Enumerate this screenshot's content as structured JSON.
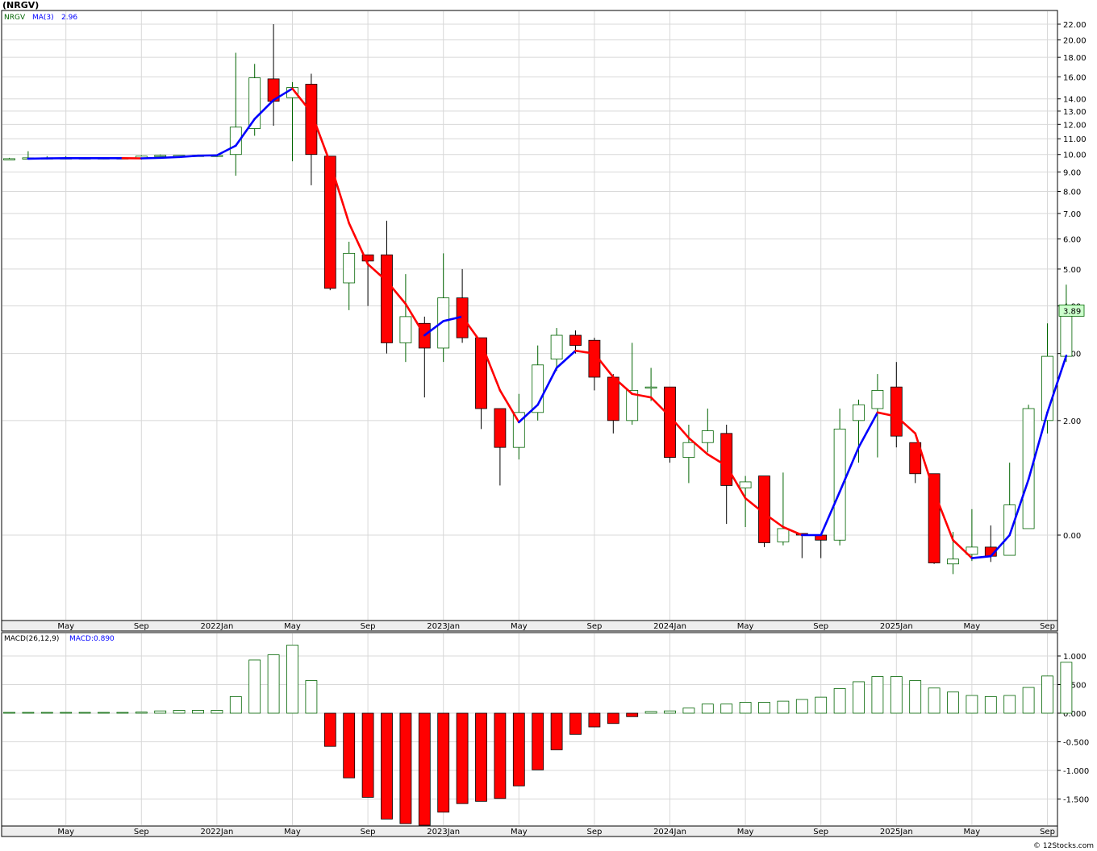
{
  "title": "(NRGV)",
  "watermark": "© 12Stocks.com",
  "legend": {
    "symbol": "NRGV",
    "ma_label": "MA(3)",
    "ma_value": "2.96",
    "macd_params": "MACD(26,12,9)",
    "macd_label": "MACD:0.890"
  },
  "last_price": "3.89",
  "colors": {
    "up": "#006400",
    "down": "#ff0000",
    "ma_up": "#0000ff",
    "ma_down": "#ff0000",
    "last_price_bg": "#ccffcc",
    "grid": "#d8d8d8",
    "axis_strip": "#eeeeee"
  },
  "chart_data": [
    {
      "type": "candlestick",
      "scale": "log",
      "title": "(NRGV)",
      "y_tick_labels": [
        "22.00",
        "20.00",
        "18.00",
        "16.00",
        "14.00",
        "13.00",
        "12.00",
        "11.00",
        "10.00",
        "9.00",
        "8.00",
        "7.00",
        "6.00",
        "5.00",
        "4.00",
        "3.00",
        "2.00",
        "0.00"
      ],
      "y_tick_values": [
        22,
        20,
        18,
        16,
        14,
        13,
        12,
        11,
        10,
        9,
        8,
        7,
        6,
        5,
        4,
        3,
        2,
        1
      ],
      "x_tick_labels": [
        "May",
        "Sep",
        "2022Jan",
        "May",
        "Sep",
        "2023Jan",
        "May",
        "Sep",
        "2024Jan",
        "May",
        "Sep",
        "2025Jan",
        "May",
        "Sep"
      ],
      "x_tick_month_index": [
        3,
        7,
        11,
        15,
        19,
        23,
        27,
        31,
        35,
        39,
        43,
        47,
        51,
        55
      ],
      "candles": [
        {
          "o": 9.75,
          "h": 9.8,
          "l": 9.7,
          "c": 9.75
        },
        {
          "o": 9.75,
          "h": 10.2,
          "l": 9.7,
          "c": 9.8
        },
        {
          "o": 9.78,
          "h": 9.9,
          "l": 9.72,
          "c": 9.8
        },
        {
          "o": 9.8,
          "h": 9.9,
          "l": 9.75,
          "c": 9.8
        },
        {
          "o": 9.8,
          "h": 9.8,
          "l": 9.8,
          "c": 9.8
        },
        {
          "o": 9.8,
          "h": 9.8,
          "l": 9.8,
          "c": 9.8
        },
        {
          "o": 9.8,
          "h": 9.8,
          "l": 9.8,
          "c": 9.8
        },
        {
          "o": 9.75,
          "h": 9.95,
          "l": 9.7,
          "c": 9.9
        },
        {
          "o": 9.9,
          "h": 10.0,
          "l": 9.85,
          "c": 9.95
        },
        {
          "o": 9.95,
          "h": 9.95,
          "l": 9.95,
          "c": 9.95
        },
        {
          "o": 9.95,
          "h": 9.95,
          "l": 9.95,
          "c": 9.95
        },
        {
          "o": 9.95,
          "h": 9.95,
          "l": 9.95,
          "c": 9.95
        },
        {
          "o": 10.0,
          "h": 18.5,
          "l": 8.8,
          "c": 11.8
        },
        {
          "o": 11.7,
          "h": 17.3,
          "l": 11.2,
          "c": 15.9
        },
        {
          "o": 15.8,
          "h": 22.0,
          "l": 11.9,
          "c": 13.8
        },
        {
          "o": 14.1,
          "h": 15.5,
          "l": 9.6,
          "c": 15.0
        },
        {
          "o": 15.3,
          "h": 16.3,
          "l": 8.3,
          "c": 10.0
        },
        {
          "o": 9.9,
          "h": 9.9,
          "l": 4.4,
          "c": 4.45
        },
        {
          "o": 4.6,
          "h": 5.9,
          "l": 3.9,
          "c": 5.5
        },
        {
          "o": 5.45,
          "h": 5.45,
          "l": 4.0,
          "c": 5.25
        },
        {
          "o": 5.45,
          "h": 6.7,
          "l": 3.0,
          "c": 3.2
        },
        {
          "o": 3.2,
          "h": 4.85,
          "l": 2.85,
          "c": 3.75
        },
        {
          "o": 3.6,
          "h": 3.75,
          "l": 2.3,
          "c": 3.1
        },
        {
          "o": 3.1,
          "h": 5.5,
          "l": 2.85,
          "c": 4.2
        },
        {
          "o": 4.2,
          "h": 5.0,
          "l": 3.2,
          "c": 3.3
        },
        {
          "o": 3.3,
          "h": 3.3,
          "l": 1.9,
          "c": 2.15
        },
        {
          "o": 2.15,
          "h": 2.15,
          "l": 1.35,
          "c": 1.7
        },
        {
          "o": 1.7,
          "h": 2.35,
          "l": 1.58,
          "c": 2.1
        },
        {
          "o": 2.1,
          "h": 3.15,
          "l": 2.0,
          "c": 2.8
        },
        {
          "o": 2.9,
          "h": 3.5,
          "l": 2.7,
          "c": 3.35
        },
        {
          "o": 3.35,
          "h": 3.45,
          "l": 3.0,
          "c": 3.15
        },
        {
          "o": 3.25,
          "h": 3.3,
          "l": 2.4,
          "c": 2.6
        },
        {
          "o": 2.6,
          "h": 2.65,
          "l": 1.85,
          "c": 2.0
        },
        {
          "o": 2.0,
          "h": 3.2,
          "l": 1.95,
          "c": 2.4
        },
        {
          "o": 2.45,
          "h": 2.75,
          "l": 2.25,
          "c": 2.45
        },
        {
          "o": 2.45,
          "h": 2.45,
          "l": 1.55,
          "c": 1.6
        },
        {
          "o": 1.6,
          "h": 1.95,
          "l": 1.37,
          "c": 1.75
        },
        {
          "o": 1.75,
          "h": 2.15,
          "l": 1.65,
          "c": 1.88
        },
        {
          "o": 1.85,
          "h": 1.95,
          "l": 1.07,
          "c": 1.35
        },
        {
          "o": 1.33,
          "h": 1.43,
          "l": 1.05,
          "c": 1.38
        },
        {
          "o": 1.43,
          "h": 1.43,
          "l": 0.93,
          "c": 0.955
        },
        {
          "o": 0.96,
          "h": 1.46,
          "l": 0.94,
          "c": 1.04
        },
        {
          "o": 1.01,
          "h": 1.01,
          "l": 0.87,
          "c": 1.0
        },
        {
          "o": 1.0,
          "h": 1.0,
          "l": 0.87,
          "c": 0.97
        },
        {
          "o": 0.97,
          "h": 2.15,
          "l": 0.94,
          "c": 1.9
        },
        {
          "o": 2.0,
          "h": 2.27,
          "l": 1.55,
          "c": 2.2
        },
        {
          "o": 2.15,
          "h": 2.65,
          "l": 1.6,
          "c": 2.4
        },
        {
          "o": 2.45,
          "h": 2.85,
          "l": 1.7,
          "c": 1.82
        },
        {
          "o": 1.75,
          "h": 1.75,
          "l": 1.37,
          "c": 1.45
        },
        {
          "o": 1.45,
          "h": 1.45,
          "l": 0.84,
          "c": 0.845
        },
        {
          "o": 0.84,
          "h": 1.02,
          "l": 0.79,
          "c": 0.865
        },
        {
          "o": 0.89,
          "h": 1.17,
          "l": 0.855,
          "c": 0.93
        },
        {
          "o": 0.93,
          "h": 1.06,
          "l": 0.85,
          "c": 0.88
        },
        {
          "o": 0.885,
          "h": 1.55,
          "l": 0.885,
          "c": 1.2
        },
        {
          "o": 1.04,
          "h": 2.2,
          "l": 1.04,
          "c": 2.15
        },
        {
          "o": 2.0,
          "h": 3.6,
          "l": 1.85,
          "c": 2.95
        },
        {
          "o": 2.95,
          "h": 4.55,
          "l": 2.85,
          "c": 3.89
        }
      ],
      "ma": {
        "name": "MA(3)",
        "values": [
          null,
          9.75,
          9.77,
          9.78,
          9.78,
          9.78,
          9.78,
          9.77,
          9.8,
          9.85,
          9.93,
          9.95,
          10.55,
          12.4,
          13.9,
          14.9,
          12.9,
          9.5,
          6.6,
          5.15,
          4.65,
          4.05,
          3.35,
          3.65,
          3.75,
          3.2,
          2.4,
          1.98,
          2.2,
          2.75,
          3.05,
          3.0,
          2.6,
          2.35,
          2.3,
          2.05,
          1.8,
          1.63,
          1.52,
          1.25,
          1.14,
          1.05,
          1.0,
          1.0,
          1.3,
          1.7,
          2.1,
          2.05,
          1.85,
          1.3,
          0.97,
          0.87,
          0.88,
          1.0,
          1.4,
          2.1,
          2.96
        ]
      }
    },
    {
      "type": "bar",
      "title": "MACD(26,12,9)",
      "y_tick_labels": [
        "1.000",
        "0.500",
        "0.000",
        "-0.500",
        "-1.000",
        "-1.500"
      ],
      "y_tick_values": [
        1.0,
        0.5,
        0.0,
        -0.5,
        -1.0,
        -1.5
      ],
      "x_tick_labels": [
        "May",
        "Sep",
        "2022Jan",
        "May",
        "Sep",
        "2023Jan",
        "May",
        "Sep",
        "2024Jan",
        "May",
        "Sep",
        "2025Jan",
        "May",
        "Sep"
      ],
      "values": [
        0,
        0,
        0,
        0,
        0,
        0,
        0.01,
        0.02,
        0.04,
        0.05,
        0.05,
        0.05,
        0.29,
        0.93,
        1.02,
        1.19,
        0.57,
        -0.58,
        -1.13,
        -1.47,
        -1.85,
        -1.93,
        -1.96,
        -1.73,
        -1.58,
        -1.54,
        -1.49,
        -1.27,
        -0.99,
        -0.64,
        -0.37,
        -0.24,
        -0.18,
        -0.06,
        0.03,
        0.04,
        0.09,
        0.16,
        0.16,
        0.19,
        0.19,
        0.21,
        0.24,
        0.28,
        0.43,
        0.55,
        0.64,
        0.64,
        0.57,
        0.44,
        0.37,
        0.31,
        0.29,
        0.31,
        0.45,
        0.65,
        0.89
      ]
    }
  ]
}
